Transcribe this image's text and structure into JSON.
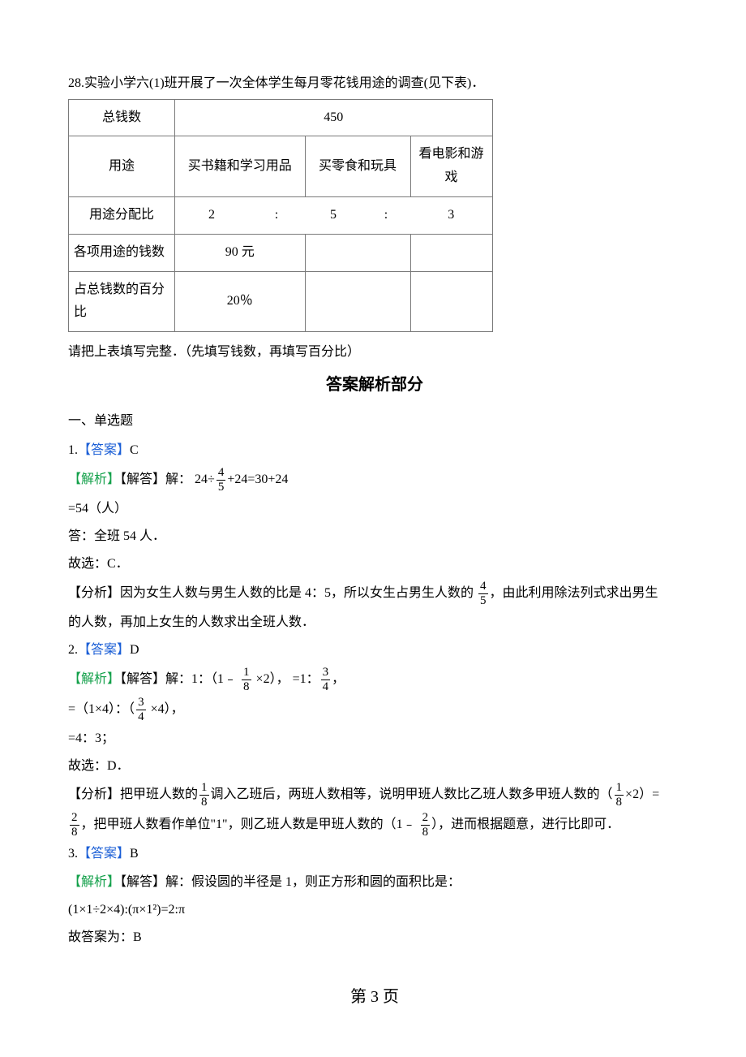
{
  "question28": {
    "text": "28.实验小学六(1)班开展了一次全体学生每月零花钱用途的调查(见下表)．",
    "table": {
      "rows": {
        "total_label": "总钱数",
        "total_value": "450",
        "usage_label": "用途",
        "usage_col1": "买书籍和学习用品",
        "usage_col2": "买零食和玩具",
        "usage_col3": "看电影和游戏",
        "ratio_label": "用途分配比",
        "ratio_c1": "2",
        "ratio_sep1": ":",
        "ratio_c2": "5",
        "ratio_sep2": ":",
        "ratio_c3": "3",
        "money_label": "各项用途的钱数",
        "money_c1": "90 元",
        "money_c2": "",
        "money_c3": "",
        "pct_label": "占总钱数的百分比",
        "pct_c1": "20％",
        "pct_c2": "",
        "pct_c3": ""
      }
    },
    "fill_note": "请把上表填写完整．（先填写钱数，再填写百分比）"
  },
  "answer_section_title": "答案解析部分",
  "section1_heading": "一、单选题",
  "a1": {
    "num": "1.",
    "answer_label": "【答案】",
    "answer_val": "C",
    "expl_label": "【解析】",
    "expl_sub": "【解答】",
    "expl_prefix": "解：",
    "expr_pre": "24",
    "expr_op1": "÷",
    "frac_n": "4",
    "frac_d": "5",
    "expr_op2": "+",
    "expr_post": "24",
    "expr_eq": "=30+24",
    "line2": "=54（人）",
    "line3": "答：全班 54 人．",
    "line4": "故选：C．",
    "analysis_label": "【分析】",
    "analysis_pre": "因为女生人数与男生人数的比是 4：5，所以女生占男生人数的",
    "analysis_frac_n": "4",
    "analysis_frac_d": "5",
    "analysis_post": "，由此利用除法列式求出男生",
    "analysis_cont": "的人数，再加上女生的人数求出全班人数．"
  },
  "a2": {
    "num": "2.",
    "answer_label": "【答案】",
    "answer_val": "D",
    "expl_label": "【解析】",
    "expl_sub": "【解答】",
    "l1_pre": "解：1：（1﹣ ",
    "l1_f1n": "1",
    "l1_f1d": "8",
    "l1_mid": " ×2），   =1：",
    "l1_f2n": "3",
    "l1_f2d": "4",
    "l1_post": "，",
    "l2_pre": "=（1×4）：（",
    "l2_f1n": "3",
    "l2_f1d": "4",
    "l2_post": " ×4），",
    "l3": "=4：3；",
    "l4": "故选：D．",
    "analysis_label": "【分析】",
    "an_pre": "把甲班人数的",
    "an_f1n": "1",
    "an_f1d": "8",
    "an_mid1": "调入乙班后，两班人数相等，说明甲班人数比乙班人数多甲班人数的（",
    "an_f2n": "1",
    "an_f2d": "8",
    "an_mid2": "×2）=",
    "an_f3n": "2",
    "an_f3d": "8",
    "an_mid3": "，把甲班人数看作单位\"1\"，则乙班人数是甲班人数的（1﹣ ",
    "an_f4n": "2",
    "an_f4d": "8",
    "an_post": "），进而根据题意，进行比即可．"
  },
  "a3": {
    "num": "3.",
    "answer_label": "【答案】",
    "answer_val": "B",
    "expl_label": "【解析】",
    "expl_sub": "【解答】",
    "l1": "解：假设圆的半径是 1，则正方形和圆的面积比是：",
    "l2": "(1×1÷2×4):(π×1²)=2:π",
    "l3": "故答案为：B"
  },
  "footer": "第 3 页"
}
